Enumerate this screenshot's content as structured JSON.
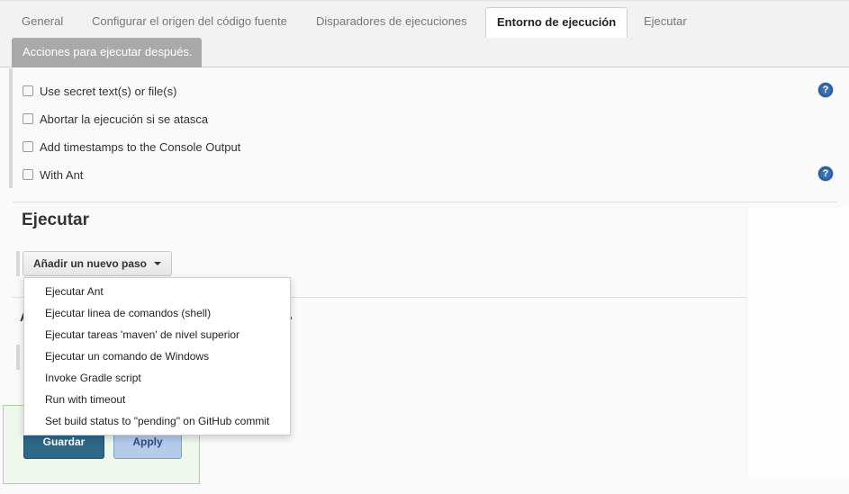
{
  "tabs": [
    {
      "label": "General",
      "active": false
    },
    {
      "label": "Configurar el origen del código fuente",
      "active": false
    },
    {
      "label": "Disparadores de ejecuciones",
      "active": false
    },
    {
      "label": "Entorno de ejecución",
      "active": true
    },
    {
      "label": "Ejecutar",
      "active": false
    },
    {
      "label": "Acciones para ejecutar después.",
      "active": false
    }
  ],
  "options": [
    {
      "label": "Use secret text(s) or file(s)",
      "checked": false,
      "help": true
    },
    {
      "label": "Abortar la ejecución si se atasca",
      "checked": false,
      "help": false
    },
    {
      "label": "Add timestamps to the Console Output",
      "checked": false,
      "help": false
    },
    {
      "label": "With Ant",
      "checked": false,
      "help": true
    }
  ],
  "help_glyph": "?",
  "build": {
    "title": "Ejecutar",
    "add_step_label": "Añadir un nuevo paso"
  },
  "menu": {
    "items": [
      "Ejecutar Ant",
      "Ejecutar linea de comandos (shell)",
      "Ejecutar tareas 'maven' de nivel superior",
      "Ejecutar un comando de Windows",
      "Invoke Gradle script",
      "Run with timeout",
      "Set build status to \"pending\" on GitHub commit"
    ]
  },
  "post_build": {
    "title_partial": "A"
  },
  "actions": {
    "save_label": "Guardar",
    "apply_label": "Apply"
  },
  "colors": {
    "help_icon": "#3a6fb0",
    "save_button": "#2e6787",
    "apply_button": "#b5cbeb",
    "save_panel": "#eef8ec"
  }
}
